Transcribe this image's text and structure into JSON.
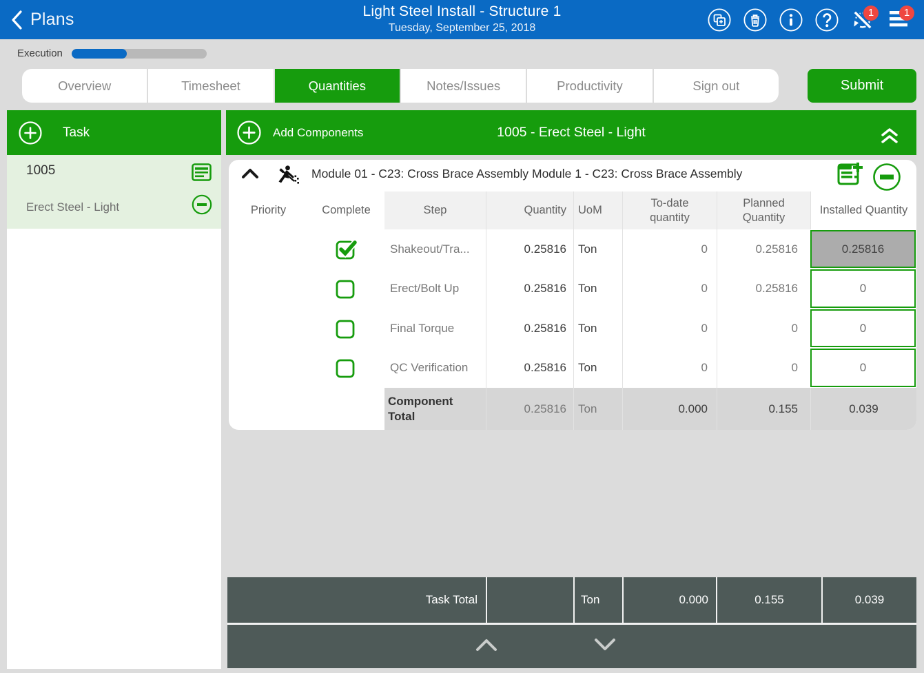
{
  "colors": {
    "header_blue": "#0A6AC4",
    "primary_green": "#169C0D",
    "slate_dark": "#4E5A58",
    "badge_red": "#EF4740",
    "selected_task_bg": "#E4F1E0"
  },
  "topbar": {
    "back_label": "Plans",
    "title": "Light Steel Install - Structure 1",
    "date": "Tuesday, September 25, 2018",
    "icons": [
      "copy-icon",
      "trash-icon",
      "info-icon",
      "help-icon",
      "sync-disabled-icon",
      "menu-icon"
    ],
    "sync_badge": "1",
    "menu_badge": "1"
  },
  "progress": {
    "label": "Execution",
    "percent": 41
  },
  "tabs": {
    "items": [
      {
        "label": "Overview",
        "active": false
      },
      {
        "label": "Timesheet",
        "active": false
      },
      {
        "label": "Quantities",
        "active": true
      },
      {
        "label": "Notes/Issues",
        "active": false
      },
      {
        "label": "Productivity",
        "active": false
      },
      {
        "label": "Sign out",
        "active": false
      }
    ],
    "submit_label": "Submit"
  },
  "task_panel": {
    "header_label": "Task",
    "task_code": "1005",
    "task_name": "Erect Steel - Light"
  },
  "main_panel": {
    "add_components_label": "Add Components",
    "header_title": "1005 - Erect Steel - Light",
    "component": {
      "title": "Module 01 - C23: Cross Brace Assembly Module 1 - C23: Cross Brace Assembly",
      "columns": {
        "priority": "Priority",
        "complete": "Complete",
        "step": "Step",
        "quantity": "Quantity",
        "uom": "UoM",
        "todate": "To-date quantity",
        "planned": "Planned Quantity",
        "installed": "Installed Quantity"
      },
      "rows": [
        {
          "complete": true,
          "step": "Shakeout/Tra...",
          "quantity": "0.25816",
          "uom": "Ton",
          "todate": "0",
          "planned": "0.25816",
          "installed": "0.25816",
          "installed_disabled": true
        },
        {
          "complete": false,
          "step": "Erect/Bolt Up",
          "quantity": "0.25816",
          "uom": "Ton",
          "todate": "0",
          "planned": "0.25816",
          "installed": "0",
          "installed_disabled": false
        },
        {
          "complete": false,
          "step": "Final Torque",
          "quantity": "0.25816",
          "uom": "Ton",
          "todate": "0",
          "planned": "0",
          "installed": "0",
          "installed_disabled": false
        },
        {
          "complete": false,
          "step": "QC Verification",
          "quantity": "0.25816",
          "uom": "Ton",
          "todate": "0",
          "planned": "0",
          "installed": "0",
          "installed_disabled": false
        }
      ],
      "total": {
        "label": "Component Total",
        "quantity": "0.25816",
        "uom": "Ton",
        "todate": "0.000",
        "planned": "0.155",
        "installed": "0.039"
      }
    },
    "task_total": {
      "label": "Task Total",
      "uom": "Ton",
      "todate": "0.000",
      "planned": "0.155",
      "installed": "0.039"
    }
  }
}
